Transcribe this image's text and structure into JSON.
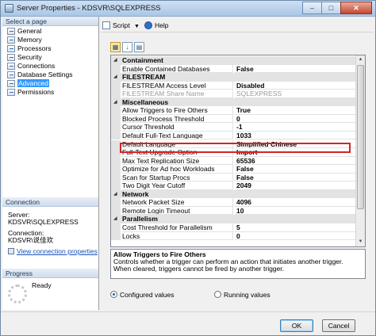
{
  "window": {
    "title": "Server Properties - KDSVR\\SQLEXPRESS",
    "minimize": "–",
    "maximize": "□",
    "close": "✕"
  },
  "left": {
    "select_page_title": "Select a page",
    "pages": [
      "General",
      "Memory",
      "Processors",
      "Security",
      "Connections",
      "Database Settings",
      "Advanced",
      "Permissions"
    ],
    "selected_page": "Advanced",
    "connection_title": "Connection",
    "server_label": "Server:",
    "server_value": "KDSVR\\SQLEXPRESS",
    "connection_label": "Connection:",
    "connection_value": "KDSVR\\说佳欢",
    "view_link": "View connection properties",
    "progress_title": "Progress",
    "progress_status": "Ready"
  },
  "toolbar": {
    "script": "Script",
    "help": "Help"
  },
  "grid": {
    "rows": [
      {
        "kind": "cat",
        "name": "Containment"
      },
      {
        "kind": "prop",
        "name": "Enable Contained Databases",
        "value": "False",
        "bold": true
      },
      {
        "kind": "cat",
        "name": "FILESTREAM"
      },
      {
        "kind": "prop",
        "name": "FILESTREAM Access Level",
        "value": "Disabled",
        "bold": true
      },
      {
        "kind": "ro",
        "name": "FILESTREAM Share Name",
        "value": "SQLEXPRESS"
      },
      {
        "kind": "cat",
        "name": "Miscellaneous"
      },
      {
        "kind": "prop",
        "name": "Allow Triggers to Fire Others",
        "value": "True",
        "bold": true
      },
      {
        "kind": "prop",
        "name": "Blocked Process Threshold",
        "value": "0",
        "bold": true
      },
      {
        "kind": "prop",
        "name": "Cursor Threshold",
        "value": "-1",
        "bold": true
      },
      {
        "kind": "prop",
        "name": "Default Full-Text Language",
        "value": "1033",
        "bold": true
      },
      {
        "kind": "prop",
        "name": "Default Language",
        "value": "Simplified Chinese",
        "bold": true
      },
      {
        "kind": "prop",
        "name": "Full-Text Upgrade Option",
        "value": "Import",
        "bold": true
      },
      {
        "kind": "prop",
        "name": "Max Text Replication Size",
        "value": "65536",
        "bold": true
      },
      {
        "kind": "prop",
        "name": "Optimize for Ad hoc Workloads",
        "value": "False",
        "bold": true
      },
      {
        "kind": "prop",
        "name": "Scan for Startup Procs",
        "value": "False",
        "bold": true
      },
      {
        "kind": "prop",
        "name": "Two Digit Year Cutoff",
        "value": "2049",
        "bold": true
      },
      {
        "kind": "cat",
        "name": "Network"
      },
      {
        "kind": "prop",
        "name": "Network Packet Size",
        "value": "4096",
        "bold": true
      },
      {
        "kind": "prop",
        "name": "Remote Login Timeout",
        "value": "10",
        "bold": true
      },
      {
        "kind": "cat",
        "name": "Parallelism"
      },
      {
        "kind": "prop",
        "name": "Cost Threshold for Parallelism",
        "value": "5",
        "bold": true
      },
      {
        "kind": "prop",
        "name": "Locks",
        "value": "0",
        "bold": true
      }
    ]
  },
  "description": {
    "title": "Allow Triggers to Fire Others",
    "text": "Controls whether a trigger can perform an action that initiates another trigger. When cleared, triggers cannot be fired by another trigger."
  },
  "values_mode": {
    "configured": "Configured values",
    "running": "Running values",
    "selected": "configured"
  },
  "buttons": {
    "ok": "OK",
    "cancel": "Cancel"
  }
}
